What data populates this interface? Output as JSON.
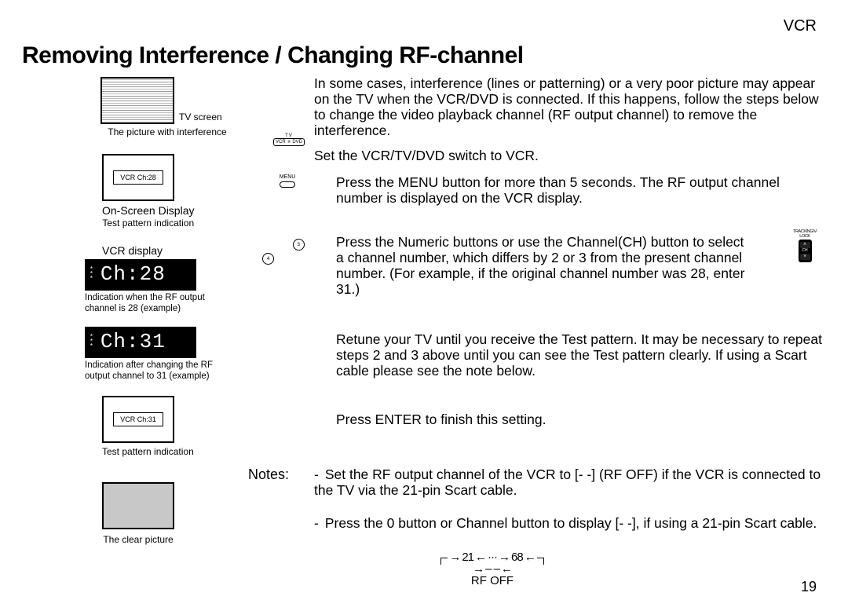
{
  "header": {
    "product": "VCR"
  },
  "page": {
    "title": "Removing Interference / Changing RF-channel",
    "number": "19"
  },
  "intro": "In some cases, interference (lines or patterning) or a very poor picture may appear on the TV when the VCR/DVD is connected. If this happens, follow the steps below to change the video playback channel (RF output channel) to remove the interference.",
  "steps": {
    "s1": "Set the VCR/TV/DVD switch to VCR.",
    "s2": "Press the MENU button for more than 5 seconds. The RF output channel number is displayed on the VCR display.",
    "s3": "Press the Numeric  buttons or use the Channel(CH)  button to select a channel number, which differs by 2 or 3 from the present channel number.  (For example, if  the original channel number was 28, enter 31.)",
    "s4": "Retune your TV until you receive the Test pattern. It may be necessary to repeat steps 2 and 3 above until you can see the Test pattern clearly.  If using a Scart cable please see the note below.",
    "s5": "Press ENTER to finish this setting."
  },
  "notes": {
    "label": "Notes:",
    "n1": "Set the RF output channel of the VCR to [- -] (RF OFF) if the VCR is connected to the TV via the 21-pin Scart cable.",
    "n2": "Press the 0 button or Channel button to display [- -], if using a 21-pin Scart cable."
  },
  "left": {
    "tv_screen": "TV screen",
    "pic_interf": "The picture with interference",
    "osd_ch28": "VCR  Ch:28",
    "osd_label": "On-Screen Display",
    "test_pattern": "Test pattern indication",
    "vcr_display": "VCR display",
    "seg_ch28": "Ch:28",
    "seg_ch28_lbl": "Indication when the RF output channel is 28 (example)",
    "seg_ch31": "Ch:31",
    "seg_ch31_lbl": "Indication after changing the RF output channel to 31 (example)",
    "osd_ch31": "VCR  Ch:31",
    "clear_pic": "The clear picture"
  },
  "icons": {
    "switch_top": "TV",
    "switch_l": "VCR",
    "switch_m": "■",
    "switch_r": "DVD",
    "menu": "MENU",
    "track": "TRACKING/V-LOCK",
    "ch": "CH"
  },
  "rfoff": {
    "row1a": "21",
    "row1b": "···",
    "row1c": "68",
    "row2": "– –",
    "label": "RF OFF"
  }
}
